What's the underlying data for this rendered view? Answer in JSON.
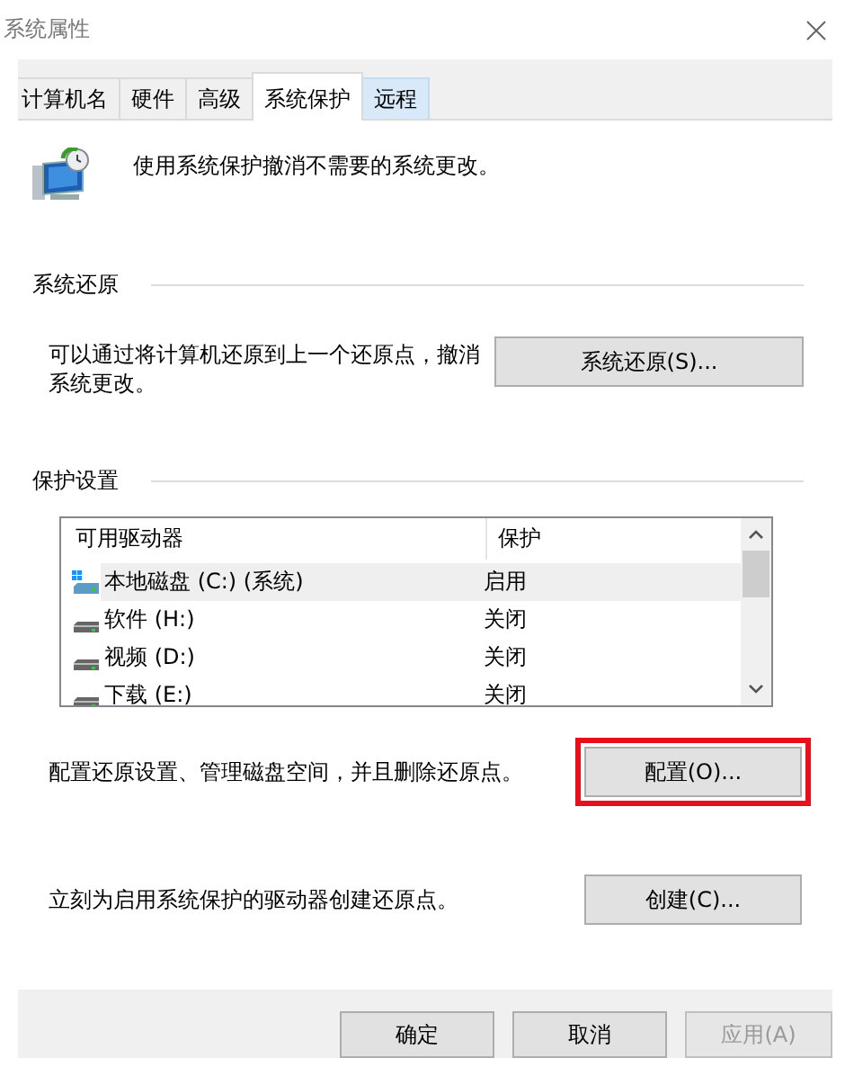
{
  "window": {
    "title": "系统属性"
  },
  "tabs": [
    {
      "label": "计算机名",
      "selected": false,
      "hover": false
    },
    {
      "label": "硬件",
      "selected": false,
      "hover": false
    },
    {
      "label": "高级",
      "selected": false,
      "hover": false
    },
    {
      "label": "系统保护",
      "selected": true,
      "hover": false
    },
    {
      "label": "远程",
      "selected": false,
      "hover": true
    }
  ],
  "intro": "使用系统保护撤消不需要的系统更改。",
  "restore_group": {
    "title": "系统还原",
    "text": "可以通过将计算机还原到上一个还原点，撤消系统更改。",
    "button": "系统还原(S)..."
  },
  "protection_group": {
    "title": "保护设置",
    "columns": [
      "可用驱动器",
      "保护"
    ],
    "drives": [
      {
        "name": "本地磁盘 (C:) (系统)",
        "protection": "启用",
        "kind": "system",
        "selected": true
      },
      {
        "name": "软件 (H:)",
        "protection": "关闭",
        "kind": "disk",
        "selected": false
      },
      {
        "name": "视频 (D:)",
        "protection": "关闭",
        "kind": "disk",
        "selected": false
      },
      {
        "name": "下载 (E:)",
        "protection": "关闭",
        "kind": "disk",
        "selected": false
      }
    ],
    "configure_text": "配置还原设置、管理磁盘空间，并且删除还原点。",
    "configure_button": {
      "label": "配置(O)...",
      "highlighted": true
    },
    "create_text": "立刻为启用系统保护的驱动器创建还原点。",
    "create_button": {
      "label": "创建(C)..."
    }
  },
  "footer_buttons": [
    {
      "label": "确定",
      "disabled": false
    },
    {
      "label": "取消",
      "disabled": false
    },
    {
      "label": "应用(A)",
      "disabled": true
    }
  ]
}
